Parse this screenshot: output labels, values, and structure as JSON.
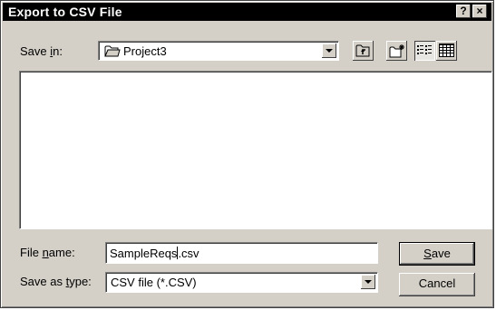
{
  "window": {
    "title": "Export to CSV File"
  },
  "titlebar": {
    "help_label": "?",
    "close_label": "×"
  },
  "save_in": {
    "label_pre": "Save ",
    "label_key": "i",
    "label_post": "n:",
    "value": "Project3",
    "icon": "folder-icon"
  },
  "toolbar": {
    "buttons": [
      {
        "name": "up-one-level",
        "icon": "up-folder-icon"
      },
      {
        "name": "create-new-folder",
        "icon": "new-folder-icon"
      },
      {
        "name": "list-view",
        "icon": "list-view-icon",
        "pressed": true
      },
      {
        "name": "details-view",
        "icon": "details-view-icon",
        "pressed": false
      }
    ]
  },
  "file_name": {
    "label_pre": "File ",
    "label_key": "n",
    "label_post": "ame:",
    "value_before_caret": "SampleReqs",
    "value_after_caret": ".csv"
  },
  "save_as_type": {
    "label_pre": "Save as ",
    "label_key": "t",
    "label_post": "ype:",
    "value": "CSV file (*.CSV)"
  },
  "buttons": {
    "save_key": "S",
    "save_rest": "ave",
    "cancel": "Cancel"
  }
}
